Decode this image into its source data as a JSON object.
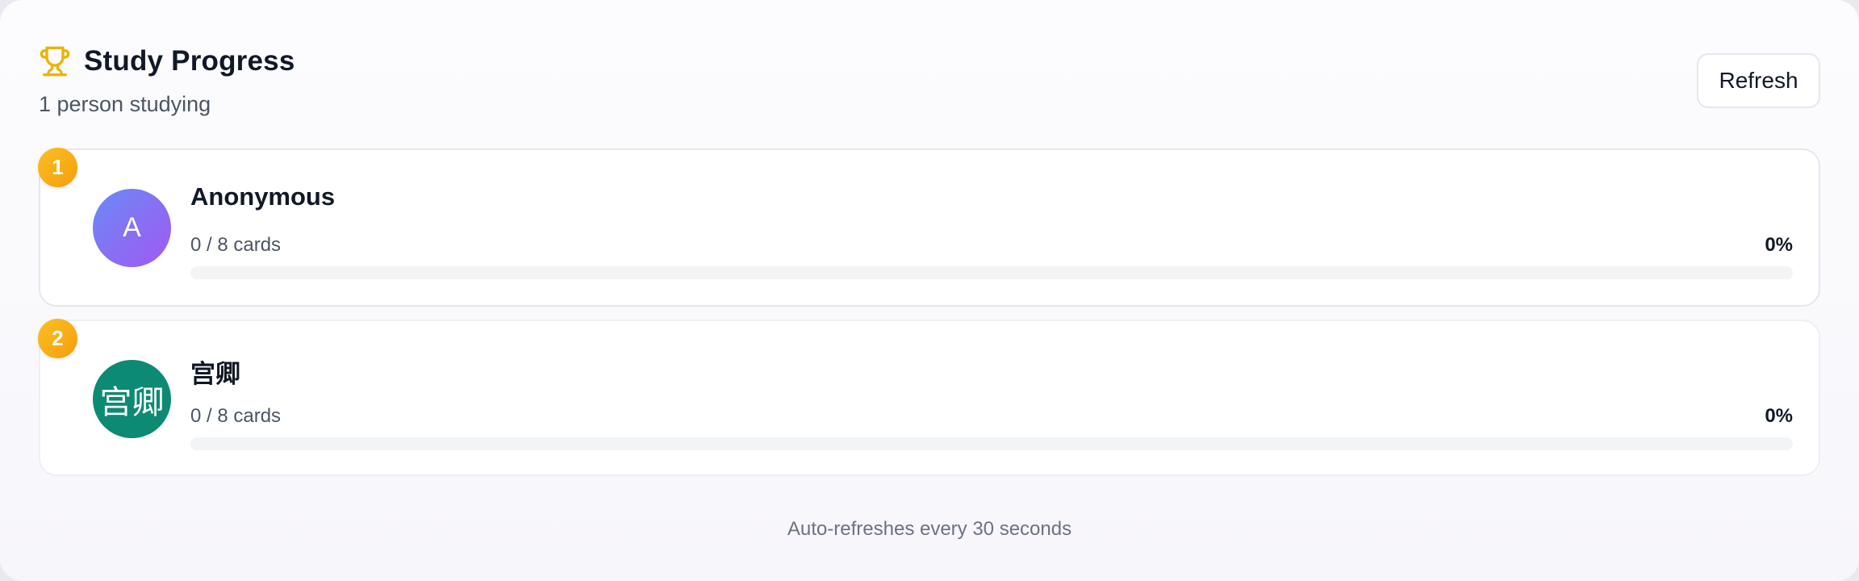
{
  "header": {
    "icon": "trophy-icon",
    "title": "Study Progress",
    "subtitle": "1 person studying",
    "refresh_label": "Refresh"
  },
  "colors": {
    "accent_rank": "#f59e0b",
    "avatar_anonymous": "#8b6ff5",
    "avatar_user2": "#0d8a73"
  },
  "participants": [
    {
      "rank": "1",
      "avatar_text": "A",
      "name": "Anonymous",
      "cards": "0 / 8 cards",
      "percent": "0%",
      "progress": 0
    },
    {
      "rank": "2",
      "avatar_text": "宫卿",
      "name": "宫卿",
      "cards": "0 / 8 cards",
      "percent": "0%",
      "progress": 0
    }
  ],
  "footer": {
    "note": "Auto-refreshes every 30 seconds"
  }
}
